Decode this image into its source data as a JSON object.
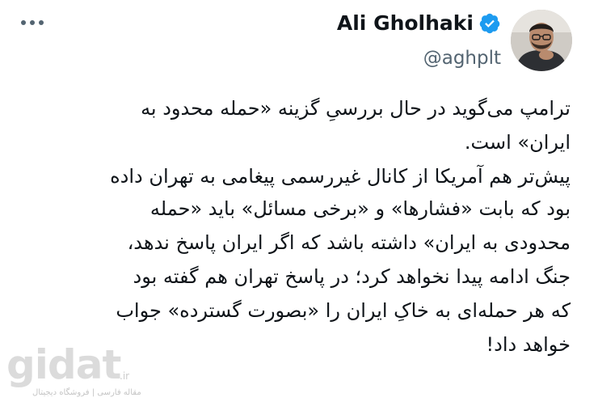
{
  "header": {
    "display_name": "Ali Gholhaki",
    "handle": "@aghplt",
    "verified_color": "#1d9bf0",
    "more_icon": "more-dots-icon"
  },
  "tweet": {
    "lines": [
      "ترامپ می‌گوید در حال بررسیِ گزینه «حمله محدود به",
      "ایران» است.",
      "پیش‌تر هم آمریکا از کانال غیررسمی پیغامی به تهران داده",
      "بود که بابت «فشارها» و «برخی مسائل» باید «حمله",
      "محدودی به ایران» داشته باشد که اگر ایران پاسخ ندهد،",
      "جنگ ادامه پیدا نخواهد کرد؛ در پاسخ تهران هم گفته بود",
      "که هر حمله‌ای به خاکِ ایران را «بصورت گسترده» جواب",
      "خواهد داد!"
    ]
  },
  "watermark": {
    "brand": "gidat",
    "tld": ".ir",
    "tagline": "مقاله فارسی | فروشگاه دیجیتال"
  }
}
